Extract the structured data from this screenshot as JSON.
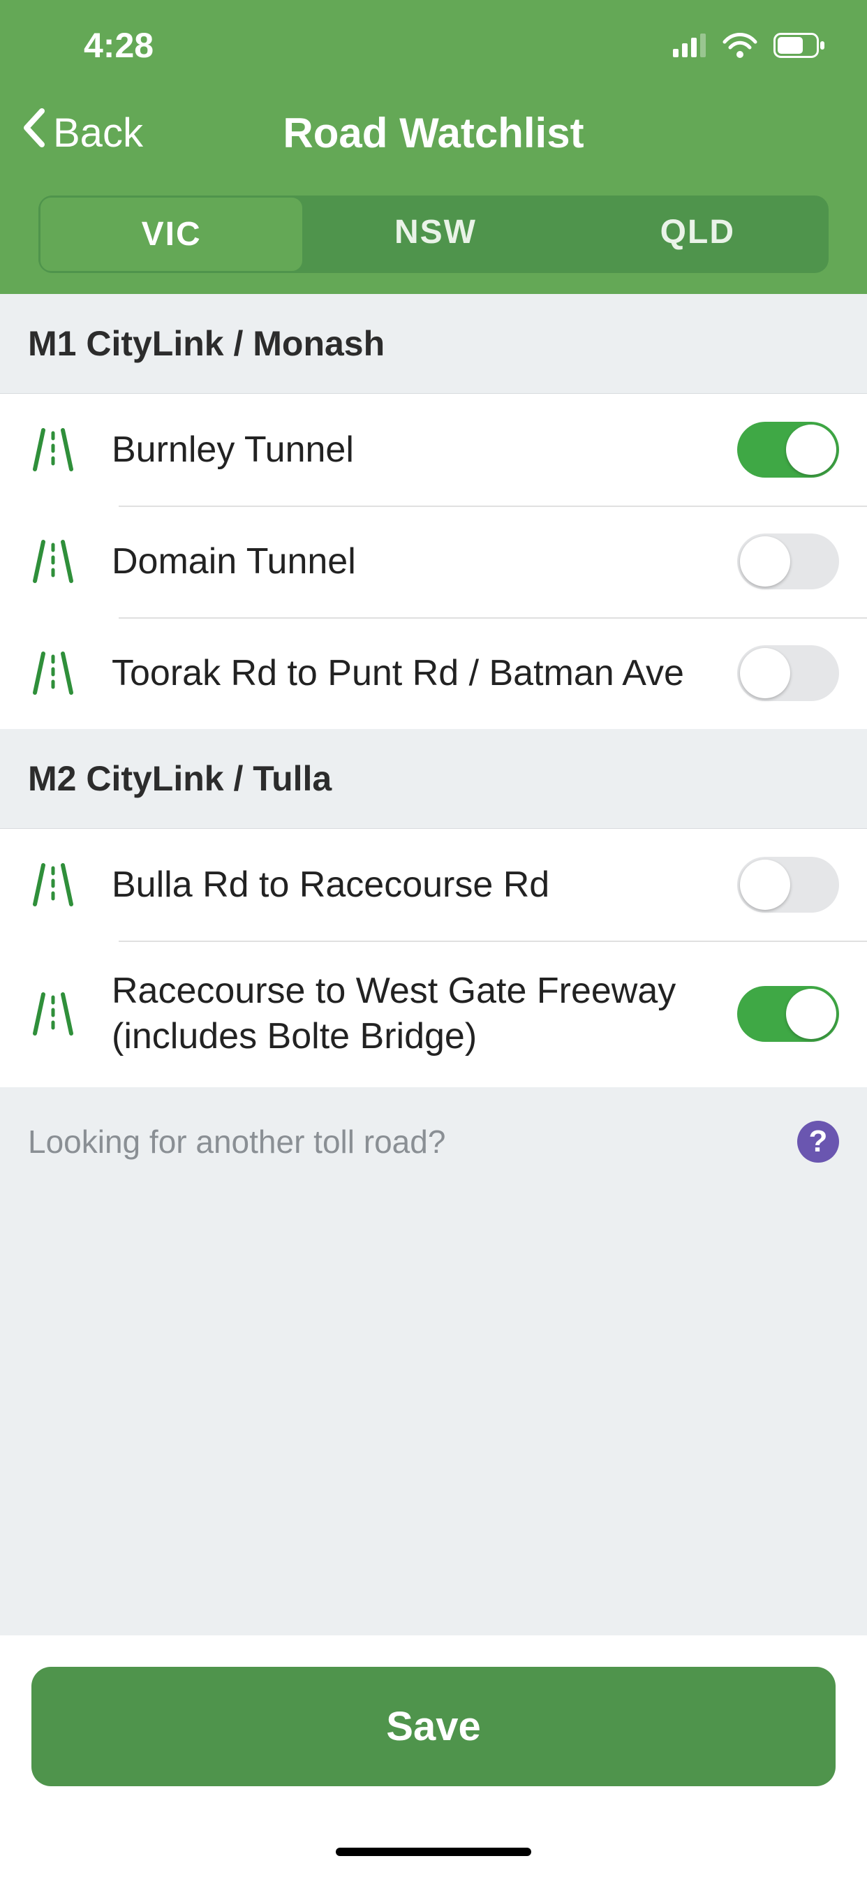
{
  "status": {
    "time": "4:28"
  },
  "nav": {
    "back": "Back",
    "title": "Road Watchlist"
  },
  "tabs": [
    {
      "label": "VIC",
      "active": true
    },
    {
      "label": "NSW",
      "active": false
    },
    {
      "label": "QLD",
      "active": false
    }
  ],
  "sections": [
    {
      "title": "M1 CityLink / Monash",
      "rows": [
        {
          "label": "Burnley Tunnel",
          "on": true
        },
        {
          "label": "Domain Tunnel",
          "on": false
        },
        {
          "label": "Toorak Rd to Punt Rd / Batman Ave",
          "on": false
        }
      ]
    },
    {
      "title": "M2 CityLink / Tulla",
      "rows": [
        {
          "label": "Bulla Rd to Racecourse Rd",
          "on": false
        },
        {
          "label": "Racecourse to West Gate Freeway (includes Bolte Bridge)",
          "on": true
        }
      ]
    }
  ],
  "footer": {
    "note": "Looking for another toll road?",
    "help": "?"
  },
  "actions": {
    "save": "Save"
  },
  "colors": {
    "accent": "#64a856",
    "toggleOn": "#3fa845",
    "help": "#6a56b0"
  }
}
